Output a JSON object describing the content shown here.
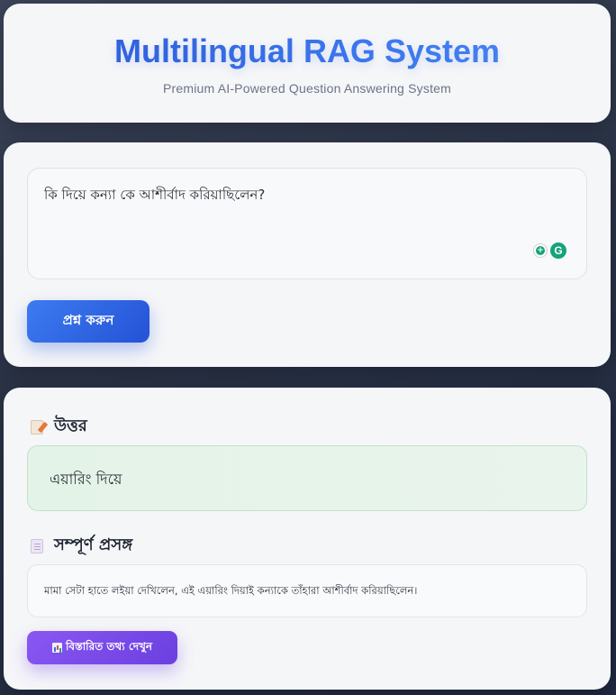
{
  "header": {
    "title": "Multilingual RAG System",
    "subtitle": "Premium AI-Powered Question Answering System"
  },
  "query": {
    "question_value": "কি দিয়ে কন্যা কে আশীর্বাদ করিয়াছিলেন?",
    "submit_label": "প্রশ্ন করুন",
    "extension_icons": [
      "grammarly-plus-icon",
      "grammarly-logo-icon"
    ]
  },
  "result": {
    "answer_heading": "উত্তর",
    "answer_icon": "memo-pencil-icon",
    "answer_text": "এয়ারিং দিয়ে",
    "context_heading": "সম্পূর্ণ প্রসঙ্গ",
    "context_icon": "document-icon",
    "context_text": "মামা সেটা হাতে লইয়া দেখিলেন, এই এয়ারিং দিয়াই কন্যাকে তাঁহারা আশীর্বাদ করিয়াছিলেন।",
    "details_label": "বিস্তারিত তথ্য দেখুন",
    "details_icon": "bar-chart-icon"
  },
  "colors": {
    "title_gradient_start": "#2b59d4",
    "title_gradient_end": "#4a8bf5",
    "primary_button": "#2f63e3",
    "answer_bg": "#e4f3e8",
    "details_button": "#7a49e6"
  }
}
